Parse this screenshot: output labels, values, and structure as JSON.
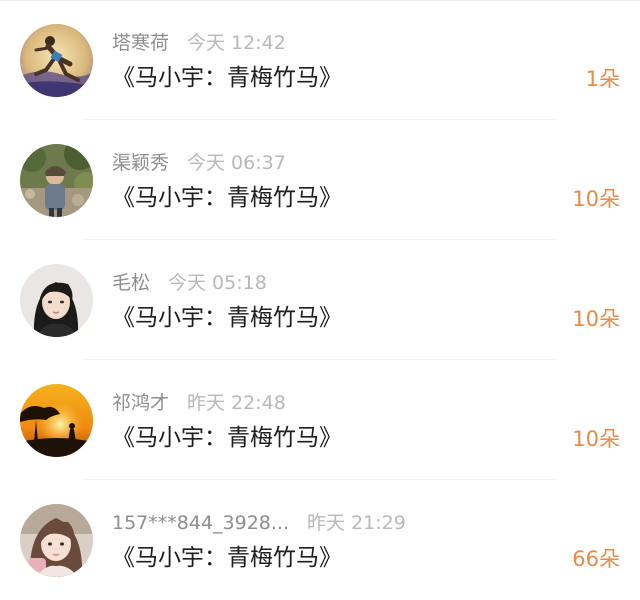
{
  "list": {
    "items": [
      {
        "name": "塔寒荷",
        "time": "今天 12:42",
        "title": "《马小宇：青梅竹马》",
        "count": "1朵",
        "avatar": "runner-painting-avatar"
      },
      {
        "name": "渠颖秀",
        "time": "今天 06:37",
        "title": "《马小宇：青梅竹马》",
        "count": "10朵",
        "avatar": "girl-in-garden-avatar"
      },
      {
        "name": "毛松",
        "time": "今天 05:18",
        "title": "《马小宇：青梅竹马》",
        "count": "10朵",
        "avatar": "girl-portrait-avatar"
      },
      {
        "name": "祁鸿才",
        "time": "昨天 22:48",
        "title": "《马小宇：青梅竹马》",
        "count": "10朵",
        "avatar": "sunset-silhouette-avatar"
      },
      {
        "name": "157***844_3928...",
        "time": "昨天 21:29",
        "title": "《马小宇：青梅竹马》",
        "count": "66朵",
        "avatar": "girl-selfie-avatar"
      }
    ]
  },
  "colors": {
    "count": "#ee8845",
    "title": "#1e1e1e",
    "meta": "#999999"
  }
}
